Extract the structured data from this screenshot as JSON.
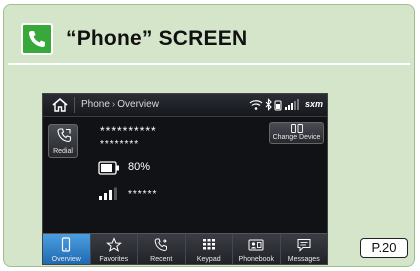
{
  "slide": {
    "title": "“Phone” SCREEN",
    "page_number": "P.20"
  },
  "screen": {
    "breadcrumb": {
      "root": "Phone",
      "separator": "›",
      "current": "Overview"
    },
    "status_icons": [
      "wifi-icon",
      "bluetooth-icon",
      "phone-battery-icon",
      "signal-strength-icon"
    ],
    "sxm_label": "sxm",
    "redial_label": "Redial",
    "change_device_label": "Change Device",
    "device_name": "**********",
    "device_number": "********",
    "battery_level": "80%",
    "carrier": "******",
    "signal_bars": 3,
    "tabs": [
      {
        "label": "Overview",
        "icon": "phone-icon",
        "active": true
      },
      {
        "label": "Favorites",
        "icon": "star-icon",
        "active": false
      },
      {
        "label": "Recent",
        "icon": "recent-calls-icon",
        "active": false
      },
      {
        "label": "Keypad",
        "icon": "keypad-icon",
        "active": false
      },
      {
        "label": "Phonebook",
        "icon": "phonebook-icon",
        "active": false
      },
      {
        "label": "Messages",
        "icon": "message-icon",
        "active": false
      }
    ]
  },
  "colors": {
    "slide_background": "#d4e5c9",
    "badge_green": "#39a83a",
    "screen_background": "#111216",
    "active_tab_blue": "#2e7fd0"
  }
}
